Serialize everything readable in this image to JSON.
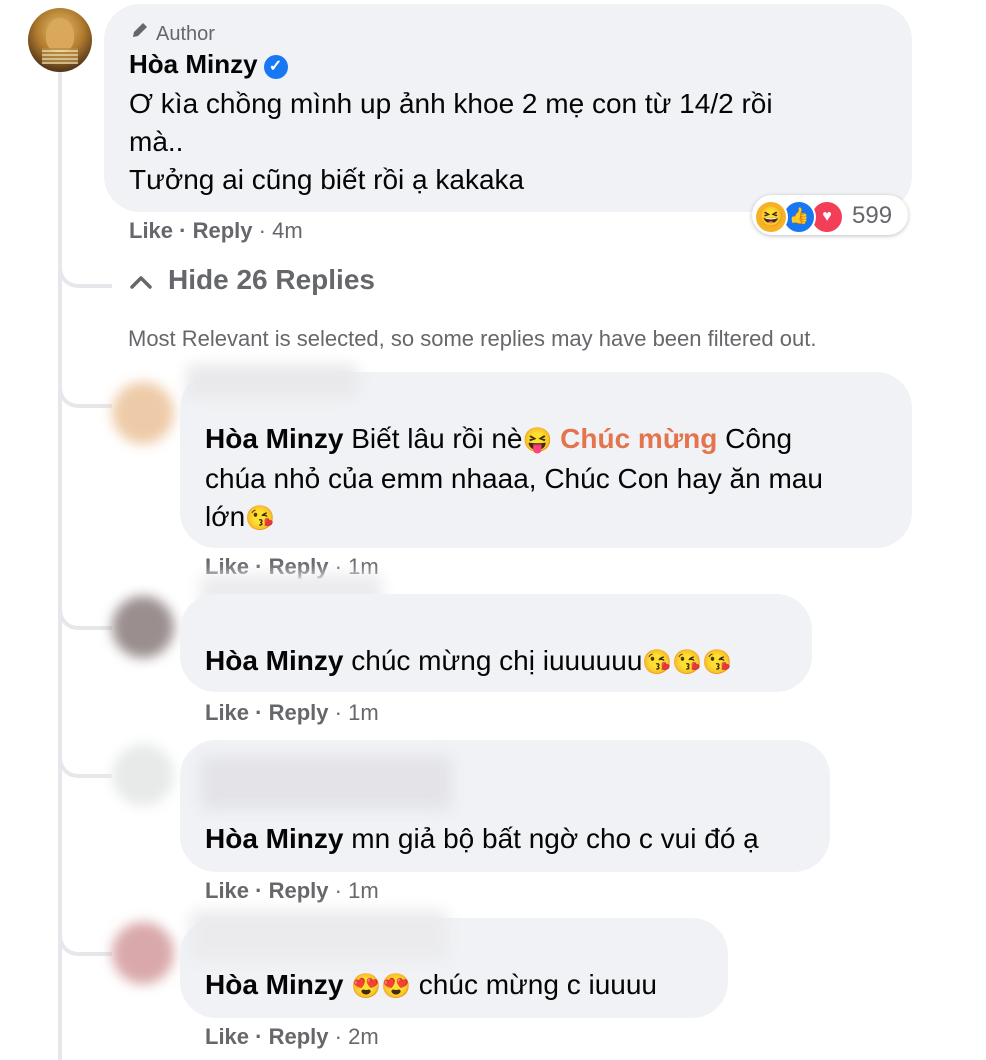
{
  "main_comment": {
    "badge": "Author",
    "author": "Hòa Minzy",
    "verified_icon": "check",
    "text_line1": "Ơ kìa chồng mình up ảnh khoe 2 mẹ con từ 14/2 rồi",
    "text_line2": "mà..",
    "text_line3": "Tưởng ai cũng biết rồi ạ kakaka",
    "like": "Like",
    "reply": "Reply",
    "time": "4m",
    "reaction_count": "599",
    "reactions": [
      "haha",
      "like",
      "love"
    ]
  },
  "thread": {
    "hide_label": "Hide 26 Replies",
    "filter_note": "Most Relevant is selected, so some replies may have been filtered out."
  },
  "replies": [
    {
      "mention": "Hòa Minzy",
      "text_a": "Biết lâu rồi nè",
      "emoji_a": "😝",
      "highlight": "Chúc mừng",
      "text_b": "Công",
      "text_line2": "chúa nhỏ của emm nhaaa, Chúc Con hay ăn mau",
      "text_line3": "lớn",
      "emoji_end": "😘",
      "like": "Like",
      "reply": "Reply",
      "time": "1m"
    },
    {
      "mention": "Hòa Minzy",
      "text": "chúc mừng chị iuuuuuu",
      "emojis": "😘😘😘",
      "like": "Like",
      "reply": "Reply",
      "time": "1m"
    },
    {
      "mention": "Hòa Minzy",
      "text": "mn giả bộ bất ngờ cho c vui đó ạ",
      "like": "Like",
      "reply": "Reply",
      "time": "1m"
    },
    {
      "mention": "Hòa Minzy",
      "emojis": "😍😍",
      "text": "chúc mừng c iuuuu",
      "like": "Like",
      "reply": "Reply",
      "time": "2m"
    }
  ],
  "colors": {
    "bubble": "#f0f2f5",
    "secondary_text": "#65676b",
    "verified": "#1877f2",
    "highlight": "#e4744d"
  }
}
